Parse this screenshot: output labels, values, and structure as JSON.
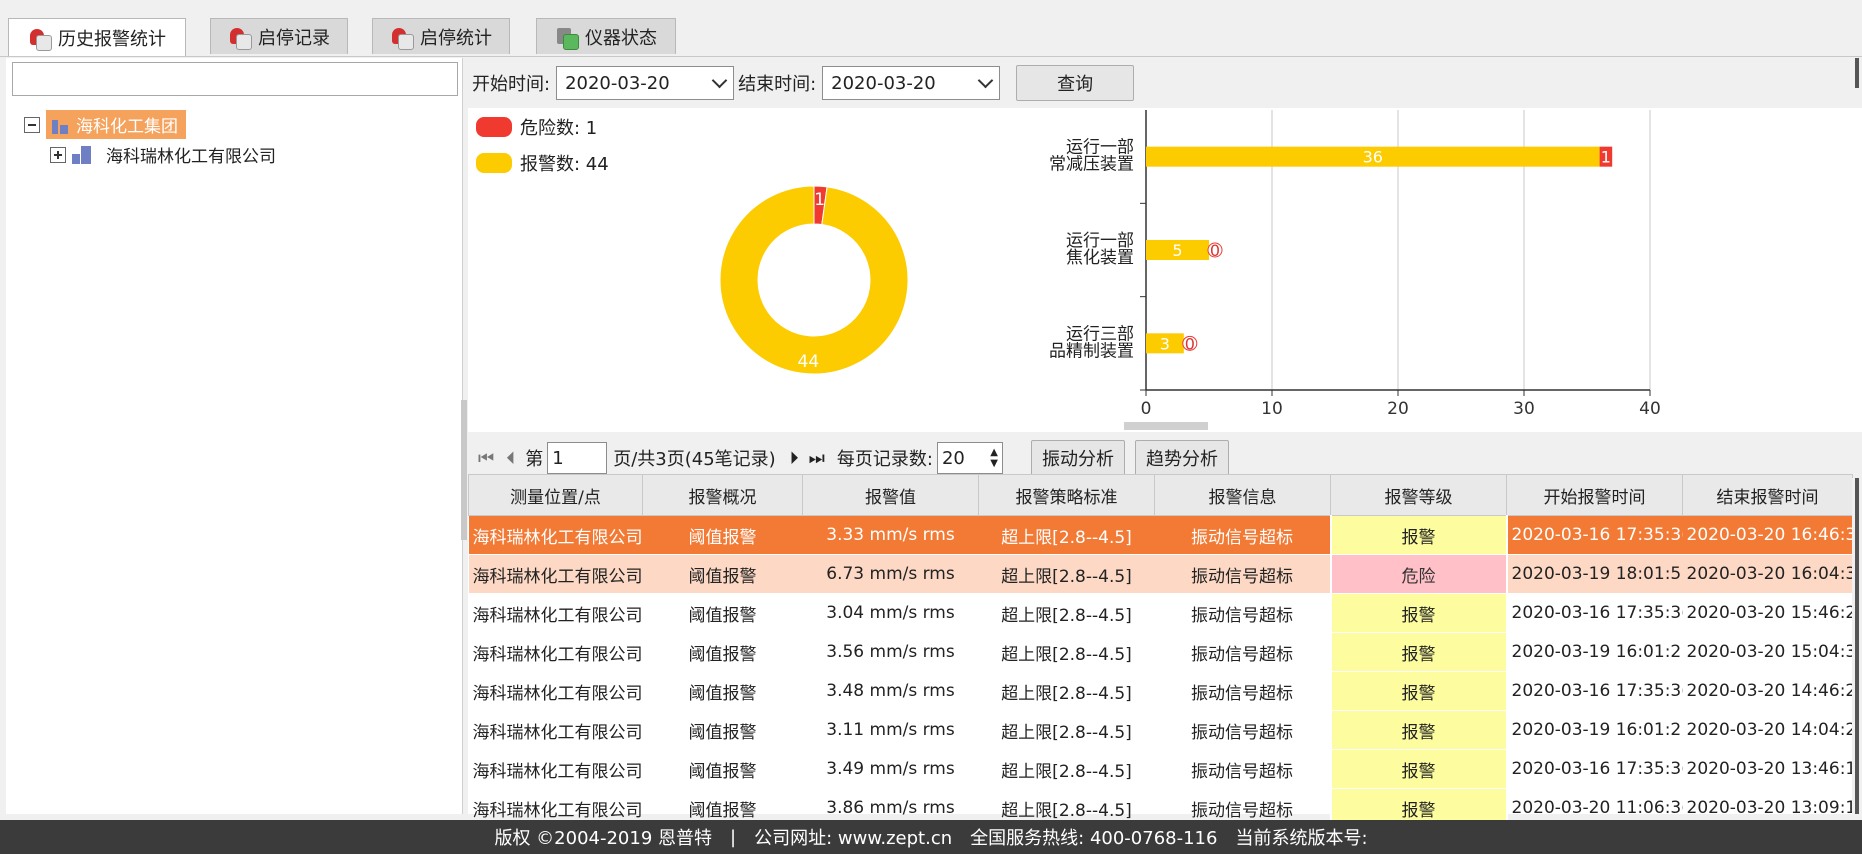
{
  "tabs": [
    {
      "label": "历史报警统计",
      "icon": "alarm-history-icon"
    },
    {
      "label": "启停记录",
      "icon": "start-stop-record-icon"
    },
    {
      "label": "启停统计",
      "icon": "start-stop-stats-icon"
    },
    {
      "label": "仪器状态",
      "icon": "instrument-status-icon"
    }
  ],
  "tree": {
    "search_value": "",
    "root": {
      "label": "海科化工集团"
    },
    "child": {
      "label": "海科瑞林化工有限公司"
    }
  },
  "filter": {
    "start_label": "开始时间:",
    "start_value": "2020-03-20",
    "end_label": "结束时间:",
    "end_value": "2020-03-20",
    "query_label": "查询"
  },
  "colors": {
    "danger": "#f03a30",
    "alarm": "#fccb00",
    "selected_row": "#f27a35",
    "alt_row": "#fdd9c5"
  },
  "legend": [
    {
      "label": "危险数: 1",
      "color": "#f03a30"
    },
    {
      "label": "报警数: 44",
      "color": "#fccb00"
    }
  ],
  "chart_data": [
    {
      "type": "pie",
      "donut": true,
      "labels": [
        "危险数",
        "报警数"
      ],
      "values": [
        1,
        44
      ],
      "colors": [
        "#f03a30",
        "#fccb00"
      ]
    },
    {
      "type": "bar",
      "orientation": "horizontal",
      "stacked": true,
      "categories": [
        [
          "运行一部",
          "常减压装置"
        ],
        [
          "运行一部",
          "焦化装置"
        ],
        [
          "运行三部",
          "品精制装置"
        ]
      ],
      "series": [
        {
          "name": "报警",
          "color": "#fccb00",
          "values": [
            36,
            5,
            3
          ]
        },
        {
          "name": "危险",
          "color": "#f03a30",
          "values": [
            1,
            0,
            0
          ]
        }
      ],
      "xlim": [
        0,
        40
      ],
      "xticks": [
        0,
        10,
        20,
        30,
        40
      ],
      "grid": true
    }
  ],
  "pager": {
    "page_prefix": "第",
    "page_value": "1",
    "page_suffix": "页/共3页(45笔记录)",
    "per_page_label": "每页记录数:",
    "per_page_value": "20",
    "vibration_btn": "振动分析",
    "trend_btn": "趋势分析"
  },
  "table": {
    "columns": [
      "测量位置/点",
      "报警概况",
      "报警值",
      "报警策略标准",
      "报警信息",
      "报警等级",
      "开始报警时间",
      "结束报警时间"
    ],
    "rows": [
      [
        "海科瑞林化工有限公司",
        "阈值报警",
        "3.33 mm/s rms",
        "超上限[2.8--4.5]",
        "振动信号超标",
        "报警",
        "2020-03-16 17:35:3(",
        "2020-03-20 16:46:3"
      ],
      [
        "海科瑞林化工有限公司",
        "阈值报警",
        "6.73 mm/s rms",
        "超上限[2.8--4.5]",
        "振动信号超标",
        "危险",
        "2020-03-19 18:01:5·",
        "2020-03-20 16:04:3"
      ],
      [
        "海科瑞林化工有限公司",
        "阈值报警",
        "3.04 mm/s rms",
        "超上限[2.8--4.5]",
        "振动信号超标",
        "报警",
        "2020-03-16 17:35:3(",
        "2020-03-20 15:46:2"
      ],
      [
        "海科瑞林化工有限公司",
        "阈值报警",
        "3.56 mm/s rms",
        "超上限[2.8--4.5]",
        "振动信号超标",
        "报警",
        "2020-03-19 16:01:2:",
        "2020-03-20 15:04:3"
      ],
      [
        "海科瑞林化工有限公司",
        "阈值报警",
        "3.48 mm/s rms",
        "超上限[2.8--4.5]",
        "振动信号超标",
        "报警",
        "2020-03-16 17:35:3(",
        "2020-03-20 14:46:2"
      ],
      [
        "海科瑞林化工有限公司",
        "阈值报警",
        "3.11 mm/s rms",
        "超上限[2.8--4.5]",
        "振动信号超标",
        "报警",
        "2020-03-19 16:01:2:",
        "2020-03-20 14:04:2"
      ],
      [
        "海科瑞林化工有限公司",
        "阈值报警",
        "3.49 mm/s rms",
        "超上限[2.8--4.5]",
        "振动信号超标",
        "报警",
        "2020-03-16 17:35:3(",
        "2020-03-20 13:46:1"
      ],
      [
        "海科瑞林化工有限公司",
        "阈值报警",
        "3.86 mm/s rms",
        "超上限[2.8--4.5]",
        "振动信号超标",
        "报警",
        "2020-03-20 11:06:3(",
        "2020-03-20 13:09:1"
      ]
    ]
  },
  "footer": {
    "copyright": "版权 ©2004-2019 恩普特",
    "sep": "|",
    "website": "公司网址: www.zept.cn",
    "hotline": "全国服务热线: 400-0768-116",
    "version": "当前系统版本号:"
  }
}
